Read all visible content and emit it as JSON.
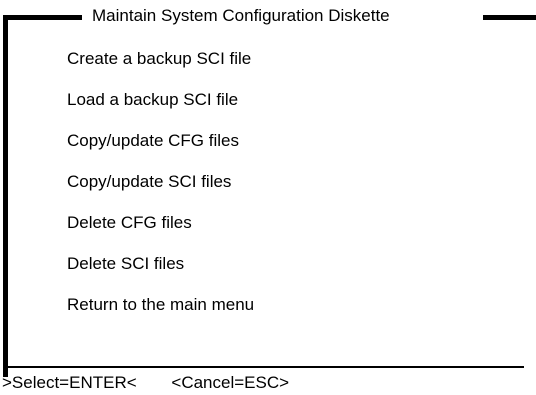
{
  "dialog": {
    "title": "Maintain System Configuration Diskette",
    "menu_items": [
      {
        "label": "Create a backup SCI file"
      },
      {
        "label": "Load a backup SCI file"
      },
      {
        "label": "Copy/update CFG files"
      },
      {
        "label": "Copy/update SCI files"
      },
      {
        "label": "Delete CFG files"
      },
      {
        "label": "Delete SCI files"
      },
      {
        "label": "Return to the main menu"
      }
    ],
    "footer": {
      "select_hint": ">Select=ENTER<",
      "cancel_hint": "<Cancel=ESC>"
    }
  }
}
